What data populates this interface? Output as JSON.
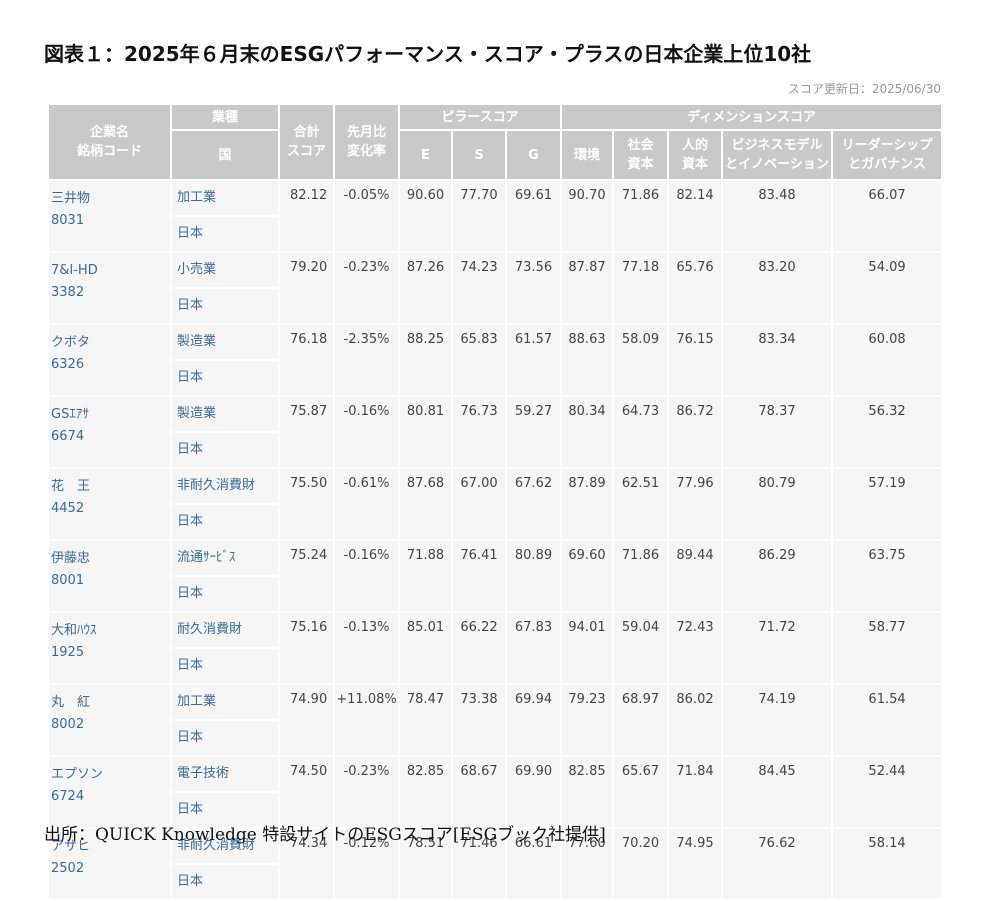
{
  "title": "図表１：2025年６月末のESGパフォーマンス・スコア・プラスの日本企業上位10社",
  "updated": "スコア更新日：2025/06/30",
  "headers": {
    "company_line1": "企業名",
    "company_line2": "銘柄コード",
    "sector": "業種",
    "country": "国",
    "total_line1": "合計",
    "total_line2": "スコア",
    "change_line1": "先月比",
    "change_line2": "変化率",
    "pillar": "ピラースコア",
    "e": "E",
    "s": "S",
    "g": "G",
    "dimension": "ディメンションスコア",
    "env": "環境",
    "social_line1": "社会",
    "social_line2": "資本",
    "human_line1": "人的",
    "human_line2": "資本",
    "biz_line1": "ビジネスモデル",
    "biz_line2": "とイノベーション",
    "lead_line1": "リーダーシップ",
    "lead_line2": "とガバナンス"
  },
  "rows": [
    {
      "name": "三井物",
      "code": "8031",
      "sector": "加工業",
      "country": "日本",
      "total": "82.12",
      "change": "-0.05%",
      "e": "90.60",
      "s": "77.70",
      "g": "69.61",
      "env": "90.70",
      "social": "71.86",
      "human": "82.14",
      "biz": "83.48",
      "lead": "66.07"
    },
    {
      "name": "7&I-HD",
      "code": "3382",
      "sector": "小売業",
      "country": "日本",
      "total": "79.20",
      "change": "-0.23%",
      "e": "87.26",
      "s": "74.23",
      "g": "73.56",
      "env": "87.87",
      "social": "77.18",
      "human": "65.76",
      "biz": "83.20",
      "lead": "54.09"
    },
    {
      "name": "クボタ",
      "code": "6326",
      "sector": "製造業",
      "country": "日本",
      "total": "76.18",
      "change": "-2.35%",
      "e": "88.25",
      "s": "65.83",
      "g": "61.57",
      "env": "88.63",
      "social": "58.09",
      "human": "76.15",
      "biz": "83.34",
      "lead": "60.08"
    },
    {
      "name": "GSｴｱｻ",
      "code": "6674",
      "sector": "製造業",
      "country": "日本",
      "total": "75.87",
      "change": "-0.16%",
      "e": "80.81",
      "s": "76.73",
      "g": "59.27",
      "env": "80.34",
      "social": "64.73",
      "human": "86.72",
      "biz": "78.37",
      "lead": "56.32"
    },
    {
      "name": "花　王",
      "code": "4452",
      "sector": "非耐久消費財",
      "country": "日本",
      "total": "75.50",
      "change": "-0.61%",
      "e": "87.68",
      "s": "67.00",
      "g": "67.62",
      "env": "87.89",
      "social": "62.51",
      "human": "77.96",
      "biz": "80.79",
      "lead": "57.19"
    },
    {
      "name": "伊藤忠",
      "code": "8001",
      "sector": "流通ｻｰﾋﾞｽ",
      "country": "日本",
      "total": "75.24",
      "change": "-0.16%",
      "e": "71.88",
      "s": "76.41",
      "g": "80.89",
      "env": "69.60",
      "social": "71.86",
      "human": "89.44",
      "biz": "86.29",
      "lead": "63.75"
    },
    {
      "name": "大和ﾊｳｽ",
      "code": "1925",
      "sector": "耐久消費財",
      "country": "日本",
      "total": "75.16",
      "change": "-0.13%",
      "e": "85.01",
      "s": "66.22",
      "g": "67.83",
      "env": "94.01",
      "social": "59.04",
      "human": "72.43",
      "biz": "71.72",
      "lead": "58.77"
    },
    {
      "name": "丸　紅",
      "code": "8002",
      "sector": "加工業",
      "country": "日本",
      "total": "74.90",
      "change": "+11.08%",
      "e": "78.47",
      "s": "73.38",
      "g": "69.94",
      "env": "79.23",
      "social": "68.97",
      "human": "86.02",
      "biz": "74.19",
      "lead": "61.54"
    },
    {
      "name": "エプソン",
      "code": "6724",
      "sector": "電子技術",
      "country": "日本",
      "total": "74.50",
      "change": "-0.23%",
      "e": "82.85",
      "s": "68.67",
      "g": "69.90",
      "env": "82.85",
      "social": "65.67",
      "human": "71.84",
      "biz": "84.45",
      "lead": "52.44"
    },
    {
      "name": "アサヒ",
      "code": "2502",
      "sector": "非耐久消費財",
      "country": "日本",
      "total": "74.34",
      "change": "-0.12%",
      "e": "78.51",
      "s": "71.46",
      "g": "66.61",
      "env": "77.60",
      "social": "70.20",
      "human": "74.95",
      "biz": "76.62",
      "lead": "58.14"
    }
  ],
  "colors": {
    "header_bg": "#c9c9c9",
    "cell_bg": "#f6f6f6",
    "link": "#3a6a9a",
    "positive_change": "#e03333",
    "negative_change": "#2e9a3e"
  },
  "source": "出所：QUICK Knowledge 特設サイトのESGスコア[ESGブック社提供]"
}
